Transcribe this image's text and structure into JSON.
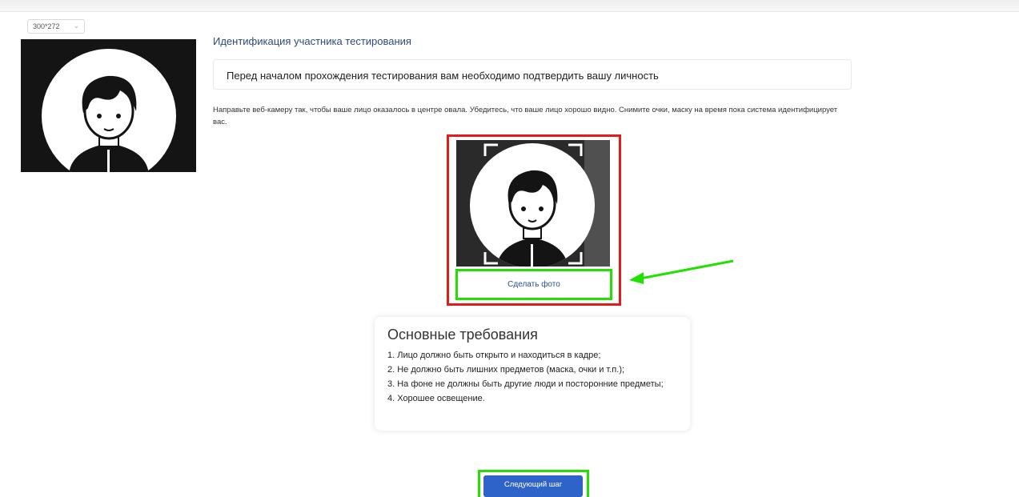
{
  "resolution_select": {
    "value": "300*272"
  },
  "page": {
    "title": "Идентификация участника тестирования",
    "notice": "Перед началом прохождения тестирования вам необходимо подтвердить вашу личность",
    "instructions": "Направьте веб-камеру так, чтобы ваше лицо оказалось в центре овала. Убедитесь, что ваше лицо хорошо видно. Снимите очки, маску на время пока система идентифицирует вас."
  },
  "camera": {
    "snap_label": "Сделать фото"
  },
  "requirements": {
    "title": "Основные требования",
    "items": [
      "1. Лицо должно быть открыто и находиться в кадре;",
      "2. Не должно быть лишних предметов (маска, очки и т.п.);",
      "3. На фоне не должны быть другие люди и посторонние предметы;",
      "4. Хорошее освещение."
    ]
  },
  "next_step": {
    "label": "Следующий шаг"
  },
  "colors": {
    "highlight_red": "#e21b1b",
    "highlight_green": "#22e000",
    "primary_button": "#2e63c9",
    "title_blue": "#2d4b7c"
  },
  "icons": [
    "chevron-down-icon",
    "avatar-illustration",
    "viewfinder-corners",
    "green-arrow"
  ]
}
